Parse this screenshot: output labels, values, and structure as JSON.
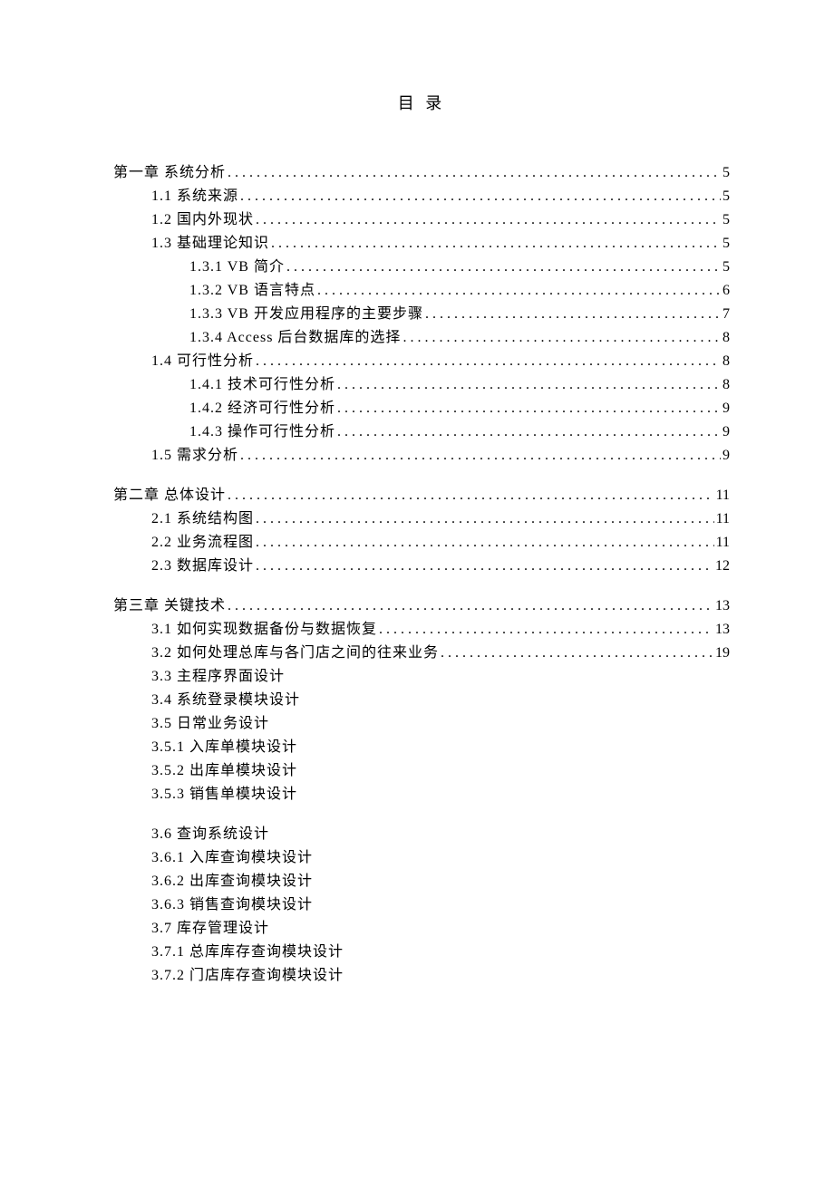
{
  "title": "目 录",
  "groups": [
    {
      "entries": [
        {
          "level": 0,
          "label": "第一章 系统分析",
          "page": "5"
        },
        {
          "level": 1,
          "label": "1.1 系统来源 ",
          "page": "5"
        },
        {
          "level": 1,
          "label": "1.2 国内外现状 ",
          "page": "5"
        },
        {
          "level": 1,
          "label": "1.3 基础理论知识 ",
          "page": "5"
        },
        {
          "level": 2,
          "label": "1.3.1 VB 简介",
          "page": "5"
        },
        {
          "level": 2,
          "label": "1.3.2 VB 语言特点",
          "page": "6"
        },
        {
          "level": 2,
          "label": "1.3.3 VB 开发应用程序的主要步骤 ",
          "page": "7"
        },
        {
          "level": 2,
          "label": "1.3.4 Access 后台数据库的选择",
          "page": "8"
        },
        {
          "level": 1,
          "label": "1.4 可行性分析 ",
          "page": "8"
        },
        {
          "level": 2,
          "label": "1.4.1 技术可行性分析",
          "page": "8"
        },
        {
          "level": 2,
          "label": "1.4.2 经济可行性分析",
          "page": "9"
        },
        {
          "level": 2,
          "label": "1.4.3 操作可行性分析",
          "page": "9"
        },
        {
          "level": 1,
          "label": "1.5 需求分析 ",
          "page": "9"
        }
      ]
    },
    {
      "entries": [
        {
          "level": 0,
          "label": "第二章 总体设计",
          "page": "11"
        },
        {
          "level": 1,
          "label": "2.1 系统结构图 ",
          "page": "11"
        },
        {
          "level": 1,
          "label": "2.2 业务流程图 ",
          "page": "11"
        },
        {
          "level": 1,
          "label": "2.3 数据库设计",
          "page": "12"
        }
      ]
    },
    {
      "entries": [
        {
          "level": 0,
          "label": "第三章 关键技术",
          "page": "13"
        },
        {
          "level": 1,
          "label": "3.1 如何实现数据备份与数据恢复 ",
          "page": "13"
        },
        {
          "level": 1,
          "label": "3.2 如何处理总库与各门店之间的往来业务 ",
          "page": "19"
        },
        {
          "level": 1,
          "label": "3.3 主程序界面设计",
          "page": ""
        },
        {
          "level": 1,
          "label": "3.4 系统登录模块设计",
          "page": ""
        },
        {
          "level": 1,
          "label": "3.5 日常业务设计",
          "page": ""
        },
        {
          "level": 1,
          "label": "3.5.1 入库单模块设计",
          "page": ""
        },
        {
          "level": 1,
          "label": "3.5.2 出库单模块设计",
          "page": ""
        },
        {
          "level": 1,
          "label": "3.5.3 销售单模块设计",
          "page": ""
        }
      ]
    },
    {
      "entries": [
        {
          "level": 1,
          "label": "3.6 查询系统设计",
          "page": ""
        },
        {
          "level": 1,
          "label": "3.6.1 入库查询模块设计",
          "page": ""
        },
        {
          "level": 1,
          "label": "3.6.2 出库查询模块设计",
          "page": ""
        },
        {
          "level": 1,
          "label": "3.6.3 销售查询模块设计",
          "page": ""
        },
        {
          "level": 1,
          "label": "3.7 库存管理设计",
          "page": ""
        },
        {
          "level": 1,
          "label": "3.7.1 总库库存查询模块设计",
          "page": ""
        },
        {
          "level": 1,
          "label": "3.7.2 门店库存查询模块设计",
          "page": ""
        }
      ]
    }
  ]
}
